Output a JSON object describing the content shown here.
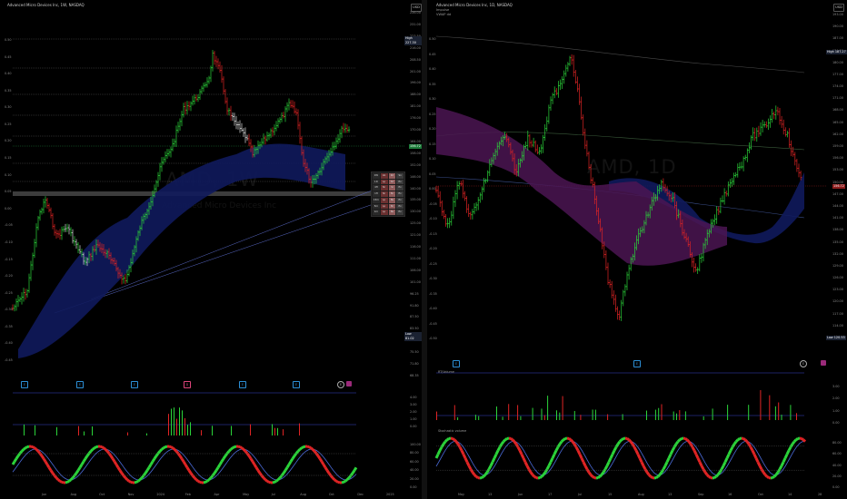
{
  "left": {
    "title": "Advanced Micro Devices Inc, 1W, NASDAQ",
    "currency": "USD",
    "watermark": "AMD, 1W",
    "watermark_sub": "Advanced Micro Devices Inc",
    "y_axis": [
      "0.50",
      "0.45",
      "0.40",
      "0.35",
      "0.30",
      "0.25",
      "0.20",
      "0.15",
      "0.10",
      "0.05",
      "0.00",
      "-0.05",
      "-0.10",
      "-0.15",
      "-0.20",
      "-0.25",
      "-0.30",
      "-0.35",
      "-0.40",
      "-0.45"
    ],
    "price_axis": [
      "236.00",
      "231.00",
      "223.50",
      "216.00",
      "208.50",
      "201.00",
      "196.00",
      "188.00",
      "181.00",
      "176.00",
      "170.00",
      "164.00",
      "158.00",
      "152.00",
      "146.00",
      "140.00",
      "135.00",
      "130.00",
      "125.00",
      "121.00",
      "116.00",
      "111.00",
      "106.00",
      "101.00",
      "96.25",
      "91.80",
      "87.50",
      "83.50",
      "79.50",
      "75.50",
      "71.80",
      "68.35"
    ],
    "high_tag": {
      "label": "High",
      "value": "227.30"
    },
    "last_tag": "156.72",
    "low_tag": {
      "label": "Low",
      "value": "81.02"
    },
    "x_axis": [
      "Jun",
      "Aug",
      "Oct",
      "Nov",
      "2024",
      "Feb",
      "Apr",
      "May",
      "Jul",
      "Aug",
      "Oct",
      "Dec",
      "2025"
    ],
    "osc1_axis": [
      "4.00",
      "3.00",
      "2.00",
      "1.00",
      "0.00"
    ],
    "osc2_axis": [
      "100.00",
      "80.00",
      "60.00",
      "40.00",
      "20.00",
      "0.00"
    ],
    "table": [
      "1W",
      "Ab",
      "Kd",
      "Sn",
      "1D",
      "Lp",
      "Sd",
      "Ex",
      "4H",
      "Nr",
      "Sl",
      "Ex",
      "1H",
      "Nr",
      "Nr",
      "Ex",
      "15m",
      "Lp",
      "Ns",
      "Ex",
      "5m",
      "Lp",
      "Nr",
      "Ex",
      "1m",
      "Lp",
      "Ns",
      "Ex"
    ]
  },
  "right": {
    "title": "Advanced Micro Devices Inc, 1D, NASDAQ",
    "subtitle1": "Impulse",
    "subtitle2": "VWAP dd",
    "currency": "USD",
    "watermark": "AMD, 1D",
    "y_axis": [
      "0.50",
      "0.45",
      "0.40",
      "0.35",
      "0.30",
      "0.25",
      "0.20",
      "0.15",
      "0.10",
      "0.05",
      "0.00",
      "-0.05",
      "-0.10",
      "-0.15",
      "-0.20",
      "-0.25",
      "-0.30",
      "-0.35",
      "-0.40",
      "-0.45",
      "-0.50"
    ],
    "price_axis": [
      "193.00",
      "190.00",
      "187.00",
      "184.00",
      "180.00",
      "177.00",
      "174.00",
      "171.00",
      "168.00",
      "165.00",
      "162.00",
      "159.00",
      "156.00",
      "153.00",
      "150.00",
      "147.00",
      "144.00",
      "141.00",
      "138.00",
      "135.00",
      "132.00",
      "129.00",
      "126.00",
      "123.00",
      "120.00",
      "117.00",
      "114.00",
      "111.00"
    ],
    "high_tag": {
      "label": "High",
      "value": "187.27"
    },
    "last_tag": "156.72",
    "low_tag": {
      "label": "Low",
      "value": "120.53"
    },
    "x_axis": [
      "May",
      "13",
      "Jun",
      "17",
      "Jul",
      "15",
      "Aug",
      "13",
      "Sep",
      "16",
      "Oct",
      "14",
      "28"
    ],
    "osc1_title": "RT/Volume",
    "osc1_axis": [
      "3.00",
      "2.00",
      "1.00",
      "0.00"
    ],
    "osc2_title": "Stochastic volume",
    "osc2_axis": [
      "80.00",
      "60.00",
      "40.00",
      "20.00",
      "0.00"
    ]
  },
  "colors": {
    "up": "#2bd43a",
    "down": "#e02424",
    "neutral": "#d8d8d8",
    "cloud": "#0f1a5c",
    "cloud_purple": "#4b1552",
    "guide": "#3a45c8"
  }
}
